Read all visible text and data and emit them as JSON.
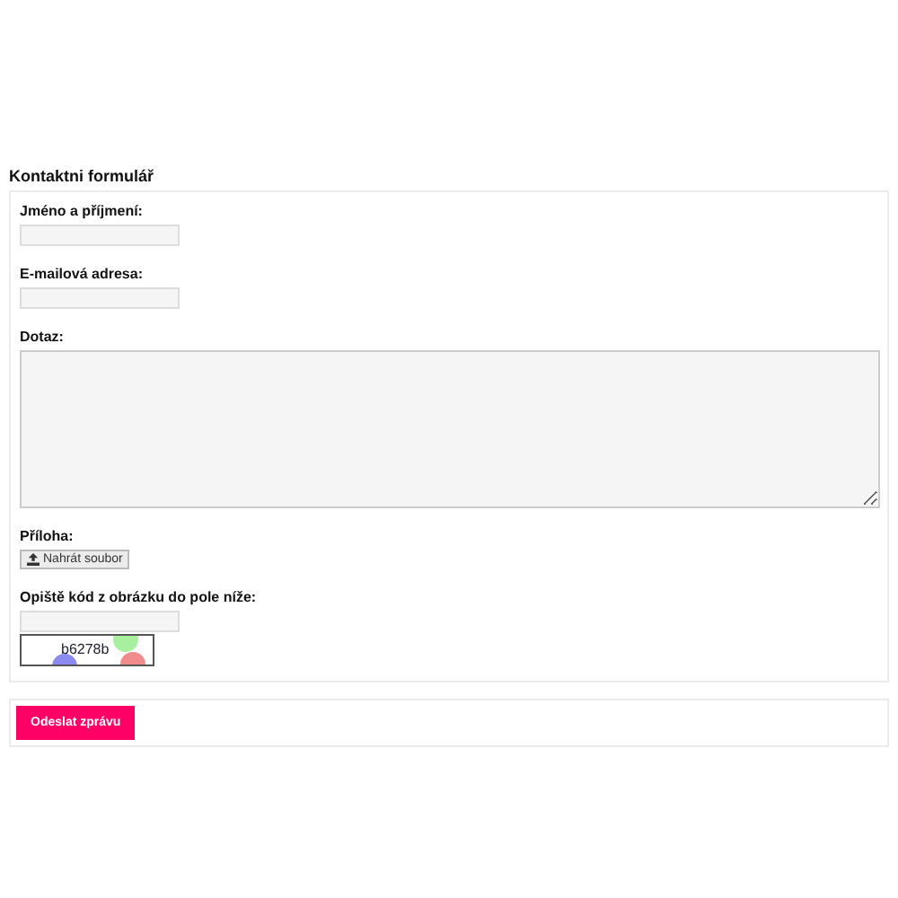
{
  "title": "Kontaktni formulář",
  "fields": [
    {
      "kind": "text",
      "label": "Jméno a příjmení:"
    },
    {
      "kind": "text",
      "label": "E-mailová adresa:"
    },
    {
      "kind": "textarea",
      "label": "Dotaz:"
    },
    {
      "kind": "file",
      "label": "Příloha:",
      "button": "Nahrát soubor"
    },
    {
      "kind": "captcha",
      "label": "Opiště kód z obrázku do pole níže:",
      "code": "b6278b"
    }
  ],
  "submit": "Odeslat zprávu"
}
